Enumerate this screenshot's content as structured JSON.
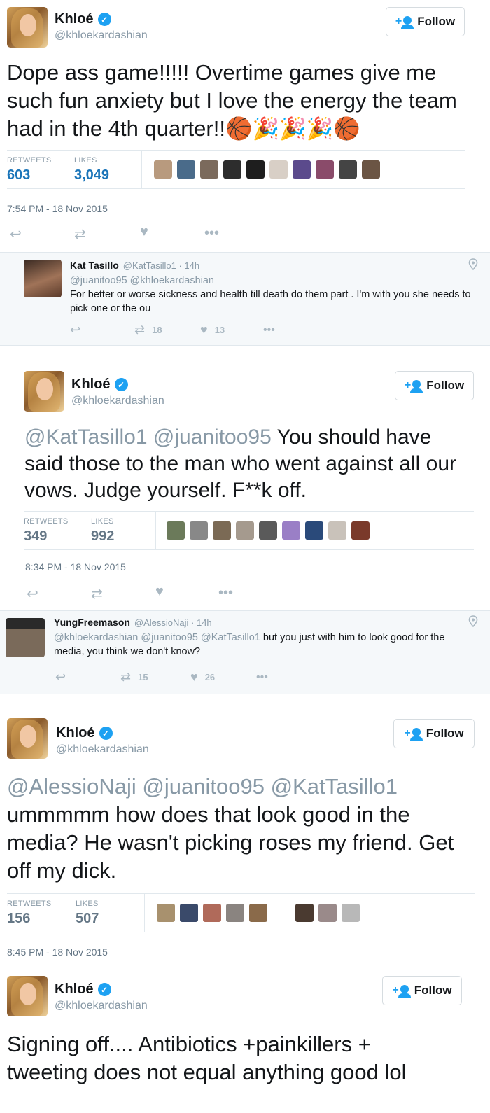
{
  "tweets": [
    {
      "name": "Khloé",
      "handle": "@khloekardashian",
      "follow_label": "Follow",
      "text": "Dope ass game!!!!! Overtime games give me such fun anxiety but I love the energy the team had in the 4th quarter!!🏀🎉🎉🎉🏀",
      "retweets_label": "RETWEETS",
      "retweets": "603",
      "likes_label": "LIKES",
      "likes": "3,049",
      "timestamp": "7:54 PM - 18 Nov 2015"
    },
    {
      "name": "Khloé",
      "handle": "@khloekardashian",
      "follow_label": "Follow",
      "mentions": "@KatTasillo1 @juanitoo95",
      "text": "You should have said those to the man who went against all our vows. Judge yourself. F**k off.",
      "retweets_label": "RETWEETS",
      "retweets": "349",
      "likes_label": "LIKES",
      "likes": "992",
      "timestamp": "8:34 PM - 18 Nov 2015"
    },
    {
      "name": "Khloé",
      "handle": "@khloekardashian",
      "follow_label": "Follow",
      "mentions": "@AlessioNaji @juanitoo95 @KatTasillo1",
      "text": "ummmmm how does that look good in the media? He wasn't picking roses my friend. Get off my dick.",
      "retweets_label": "RETWEETS",
      "retweets": "156",
      "likes_label": "LIKES",
      "likes": "507",
      "timestamp": "8:45 PM - 18 Nov 2015"
    },
    {
      "name": "Khloé",
      "handle": "@khloekardashian",
      "follow_label": "Follow",
      "text": "Signing off.... Antibiotics +painkillers + tweeting does not equal anything good lol"
    }
  ],
  "replies": [
    {
      "name": "Kat Tasillo",
      "handle_time": "@KatTasillo1 · 14h",
      "mentions": "@juanitoo95 @khloekardashian",
      "text": "For better or worse sickness and health till death do them part . I'm with you she needs to pick one or the ou",
      "retweets": "18",
      "likes": "13"
    },
    {
      "name": "YungFreemason",
      "handle_time": "@AlessioNaji · 14h",
      "mentions": "@khloekardashian @juanitoo95 @KatTasillo1",
      "text": "but you just with him to look good for the media, you think we don't know?",
      "retweets": "15",
      "likes": "26"
    }
  ],
  "colors": {
    "accent": "#1da1f2",
    "muted": "#8899a6",
    "link_count": "#1b75b9"
  },
  "icons": [
    "reply-icon",
    "retweet-icon",
    "like-icon",
    "more-icon",
    "verified-icon",
    "follow-icon",
    "location-pin-icon"
  ]
}
